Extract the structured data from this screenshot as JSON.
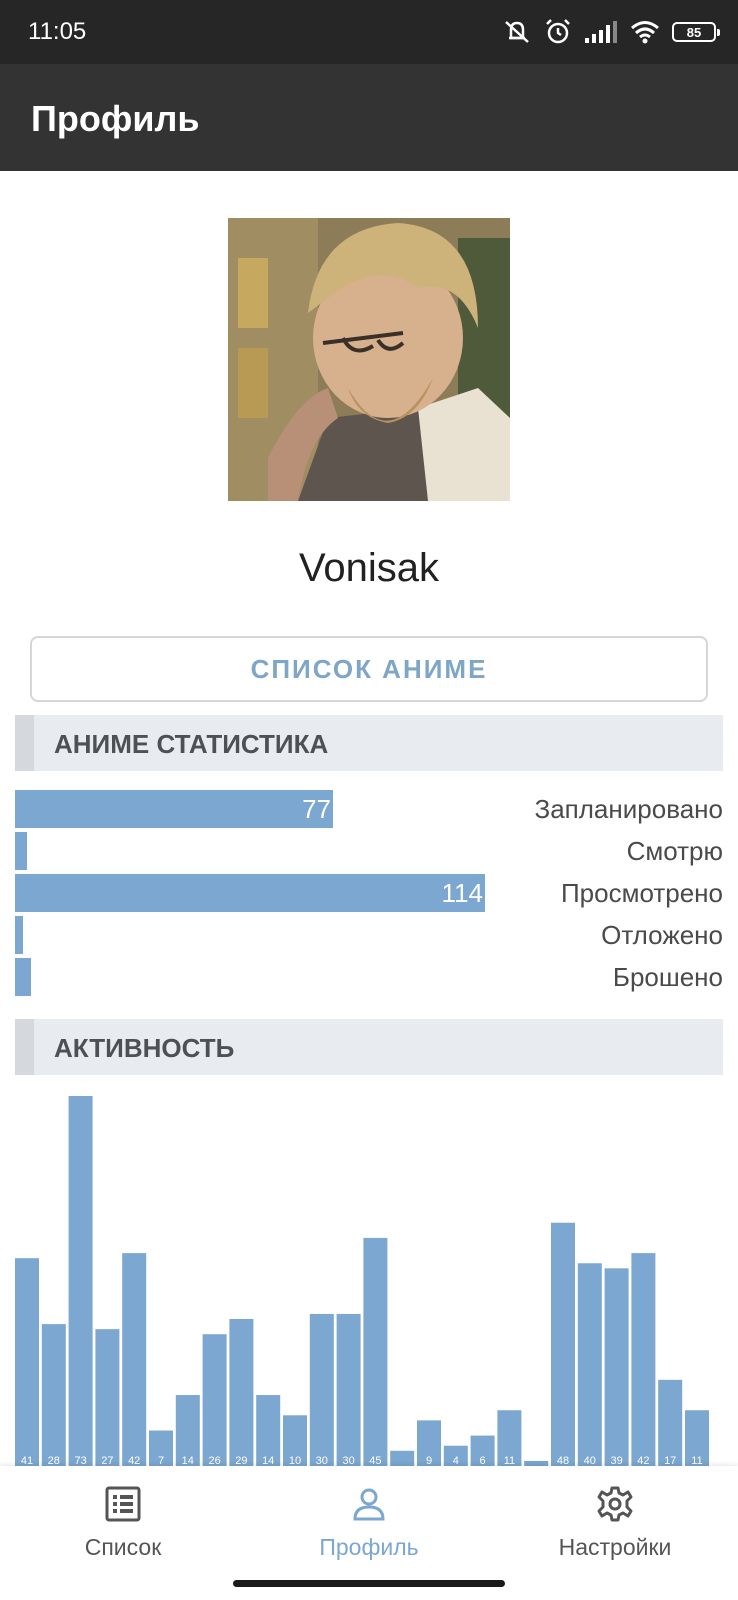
{
  "status_bar": {
    "time": "11:05",
    "battery": "85"
  },
  "app_bar": {
    "title": "Профиль"
  },
  "profile": {
    "username": "Vonisak",
    "list_button": "СПИСОК АНИМЕ"
  },
  "stats_section": {
    "title": "АНИМЕ СТАТИСТИКА",
    "rows": [
      {
        "label": "Запланировано",
        "value": 77,
        "shown_value": "77"
      },
      {
        "label": "Смотрю",
        "value": 3,
        "shown_value": ""
      },
      {
        "label": "Просмотрено",
        "value": 114,
        "shown_value": "114"
      },
      {
        "label": "Отложено",
        "value": 2,
        "shown_value": ""
      },
      {
        "label": "Брошено",
        "value": 4,
        "shown_value": ""
      }
    ]
  },
  "activity_section": {
    "title": "АКТИВНОСТЬ"
  },
  "chart_data": {
    "type": "bar",
    "title": "АКТИВНОСТЬ",
    "values": [
      41,
      28,
      73,
      27,
      42,
      7,
      14,
      26,
      29,
      14,
      10,
      30,
      30,
      45,
      3,
      9,
      4,
      6,
      11,
      1,
      48,
      40,
      39,
      42,
      17,
      11
    ],
    "labels": [
      "41",
      "28",
      "73",
      "27",
      "42",
      "7",
      "14",
      "26",
      "29",
      "14",
      "10",
      "30",
      "30",
      "45",
      "",
      "9",
      "4",
      "6",
      "11",
      "",
      "48",
      "40",
      "39",
      "42",
      "17",
      "11"
    ],
    "ylim": [
      0,
      73
    ],
    "bar_color": "#7ba7d0"
  },
  "bottom_nav": {
    "items": [
      {
        "label": "Список",
        "icon": "list-icon",
        "active": false
      },
      {
        "label": "Профиль",
        "icon": "person-icon",
        "active": true
      },
      {
        "label": "Настройки",
        "icon": "gear-icon",
        "active": false
      }
    ]
  },
  "colors": {
    "accent": "#7ba7d0",
    "app_bar": "#333333",
    "status_bar": "#262626",
    "section_header": "#e8ebef"
  }
}
